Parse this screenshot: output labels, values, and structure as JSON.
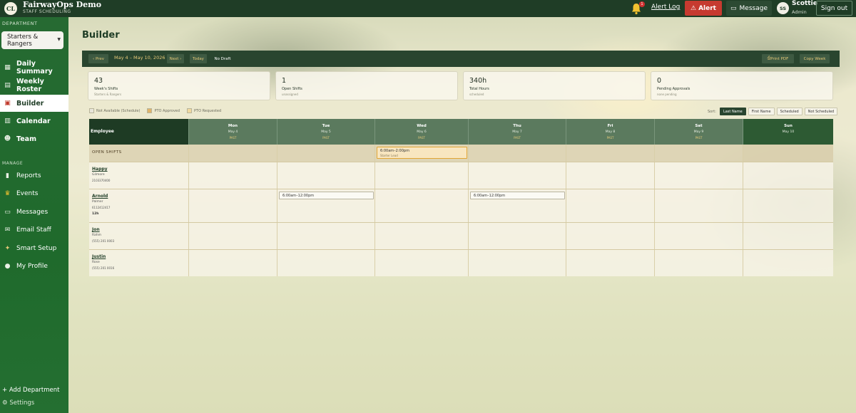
{
  "header": {
    "logo_initials": "CL",
    "title": "FairwayOps Demo",
    "subtitle": "STAFF SCHEDULING",
    "notification_count": "1",
    "alert_log": "Alert Log",
    "alert_button": "Alert",
    "message_button": "Message",
    "user_initials": "SS",
    "user_name": "Scottie",
    "user_role": "Admin",
    "sign_out": "Sign out"
  },
  "sidebar": {
    "department_label": "DEPARTMENT",
    "department_value": "Starters & Rangers",
    "items": [
      {
        "label": "Daily Summary",
        "icon": "grid-icon"
      },
      {
        "label": "Weekly Roster",
        "icon": "roster-icon"
      },
      {
        "label": "Builder",
        "icon": "calendar-31-icon"
      },
      {
        "label": "Calendar",
        "icon": "calendar-icon"
      },
      {
        "label": "Team",
        "icon": "team-icon"
      }
    ],
    "manage_label": "MANAGE",
    "manage_items": [
      {
        "label": "Reports",
        "icon": "bar-chart-icon"
      },
      {
        "label": "Events",
        "icon": "trophy-icon"
      },
      {
        "label": "Messages",
        "icon": "chat-icon"
      },
      {
        "label": "Email Staff",
        "icon": "envelope-icon"
      },
      {
        "label": "Smart Setup",
        "icon": "magic-icon"
      },
      {
        "label": "My Profile",
        "icon": "person-icon"
      }
    ],
    "add_department": "+ Add Department",
    "settings": "Settings"
  },
  "main": {
    "title": "Builder",
    "toolbar": {
      "prev": "‹ Prev",
      "range": "May 4 – May 10, 2026",
      "next": "Next ›",
      "today": "Today",
      "no_draft": "No Draft",
      "print_pdf": "Print PDF",
      "copy_week": "Copy Week"
    },
    "stats": [
      {
        "value": "43",
        "label": "Week's Shifts",
        "sub": "Starters & Rangers"
      },
      {
        "value": "1",
        "label": "Open Shifts",
        "sub": "unassigned"
      },
      {
        "value": "340h",
        "label": "Total Hours",
        "sub": "scheduled"
      },
      {
        "value": "0",
        "label": "Pending Approvals",
        "sub": "none pending"
      }
    ],
    "legend": [
      "Not Available (Schedule)",
      "PTO Approved",
      "PTO Requested"
    ],
    "legend_colors": [
      "#e8e6da",
      "#e0b46a",
      "#f0d9a0"
    ],
    "sort_label": "Sort:",
    "sort_options": [
      "Last Name",
      "First Name",
      "Scheduled",
      "Not Scheduled"
    ],
    "grid": {
      "employee_header": "Employee",
      "days": [
        {
          "day": "Mon",
          "date": "May 4",
          "past": "PAST"
        },
        {
          "day": "Tue",
          "date": "May 5",
          "past": "PAST"
        },
        {
          "day": "Wed",
          "date": "May 6",
          "past": "PAST"
        },
        {
          "day": "Thu",
          "date": "May 7",
          "past": "PAST"
        },
        {
          "day": "Fri",
          "date": "May 8",
          "past": "PAST"
        },
        {
          "day": "Sat",
          "date": "May 9",
          "past": "PAST"
        },
        {
          "day": "Sun",
          "date": "May 10",
          "past": ""
        }
      ],
      "open_shifts_label": "OPEN SHIFTS",
      "open_shift": {
        "time": "6:00am–2:00pm",
        "role": "Starter Lead"
      },
      "employees": [
        {
          "first": "Happy",
          "last": "Gilmore",
          "phone": "2103370400",
          "hours": ""
        },
        {
          "first": "Arnold",
          "last": "Palmer",
          "phone": "6112412417",
          "hours": "12h"
        },
        {
          "first": "Jon",
          "last": "Rahm",
          "phone": "(555) 201 0003",
          "hours": ""
        },
        {
          "first": "Justin",
          "last": "Rose",
          "phone": "(555) 201 0016",
          "hours": ""
        }
      ],
      "arnold_shifts": [
        "6:00am–12:00pm",
        "6:00am–12:00pm"
      ]
    }
  }
}
